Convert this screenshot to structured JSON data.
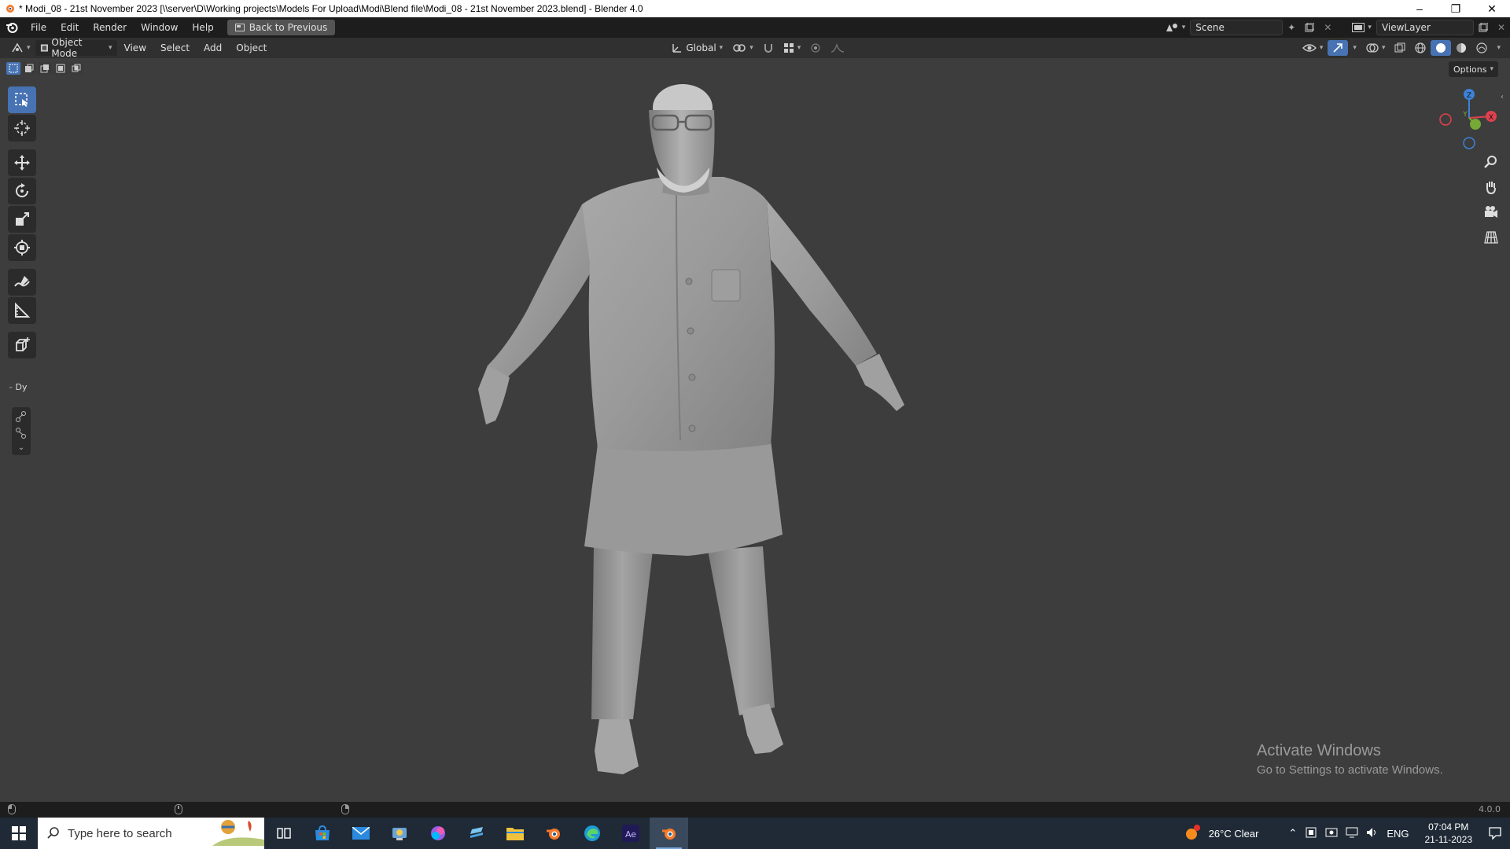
{
  "window": {
    "title": "* Modi_08 - 21st November 2023 [\\\\server\\D\\Working projects\\Models For Upload\\Modi\\Blend file\\Modi_08 - 21st November 2023.blend] - Blender 4.0"
  },
  "menu": {
    "file": "File",
    "edit": "Edit",
    "render": "Render",
    "window": "Window",
    "help": "Help",
    "back": "Back to Previous"
  },
  "scene": {
    "name": "Scene",
    "view_layer": "ViewLayer"
  },
  "header": {
    "mode": "Object Mode",
    "view": "View",
    "select": "Select",
    "add": "Add",
    "object": "Object",
    "orientation": "Global",
    "options": "Options"
  },
  "toolbar": {
    "panel_label": "Dy"
  },
  "gizmo": {
    "z": "Z",
    "y": "Y",
    "x": "X"
  },
  "activate": {
    "line1": "Activate Windows",
    "line2": "Go to Settings to activate Windows."
  },
  "status": {
    "version": "4.0.0"
  },
  "taskbar": {
    "search_placeholder": "Type here to search",
    "weather": "26°C  Clear",
    "lang": "ENG",
    "time": "07:04 PM",
    "date": "21-11-2023"
  },
  "colors": {
    "accent": "#4772b3",
    "axis_x": "#e0414e",
    "axis_y": "#76a935",
    "axis_z": "#3d82d6"
  }
}
